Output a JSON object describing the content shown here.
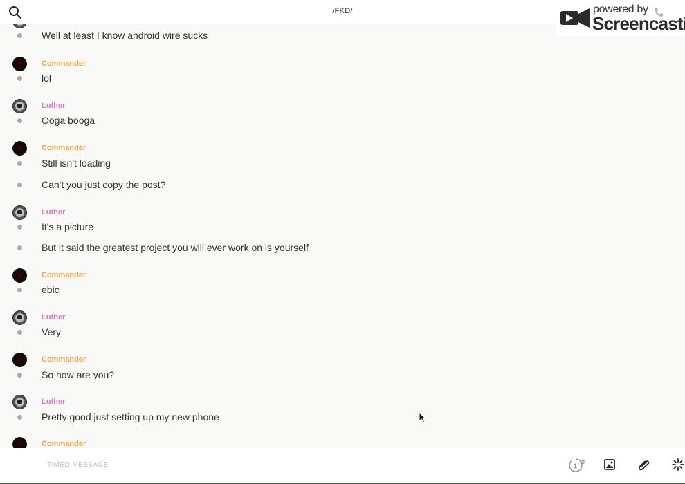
{
  "header": {
    "title": "/FKD/",
    "search_icon": "search-icon"
  },
  "watermark": {
    "powered_by": "powered by",
    "brand": "Screencastify"
  },
  "colors": {
    "commander": "#f0a040",
    "luther": "#e37ac6",
    "dot": "#a6abb0",
    "accent_bar": "#2f6e3a"
  },
  "messages": {
    "m0": "Well at least I know android wire sucks",
    "a1": "Commander",
    "m1": "lol",
    "a2": "Luther",
    "m2": "Ooga booga",
    "a3": "Commander",
    "m3": "Still isn't loading",
    "m4": "Can't you just copy the post?",
    "a5": "Luther",
    "m5": "It's a picture",
    "m6": "But it said the greatest project you will ever work on is yourself",
    "a7": "Commander",
    "m7": "ebic",
    "a8": "Luther",
    "m8": "Very",
    "a9": "Commander",
    "m9": "So how are you?",
    "a10": "Luther",
    "m10": "Pretty good just setting up my new phone",
    "a11": "Commander"
  },
  "composer": {
    "placeholder": "TIMED MESSAGE",
    "timer_value": "1",
    "timer_unit": "d",
    "icons": [
      "timer-icon",
      "image-icon",
      "attachment-icon",
      "ping-icon"
    ]
  }
}
